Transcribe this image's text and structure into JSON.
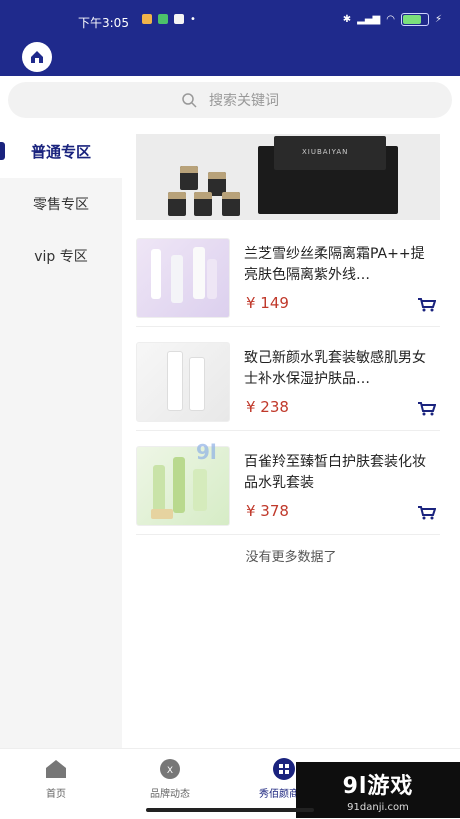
{
  "status_bar": {
    "time": "下午3:05",
    "battery_level": 0.8
  },
  "search": {
    "placeholder": "搜索关键词"
  },
  "sidebar": {
    "items": [
      {
        "label": "普通专区",
        "active": true
      },
      {
        "label": "零售专区",
        "active": false
      },
      {
        "label": "vip 专区",
        "active": false
      }
    ]
  },
  "banner": {
    "brand_text": "XIUBAIYAN"
  },
  "products": [
    {
      "name": "兰芝雪纱丝柔隔离霜PA++提亮肤色隔离紫外线…",
      "price": "¥ 149"
    },
    {
      "name": "致己新颜水乳套装敏感肌男女士补水保湿护肤品…",
      "price": "¥ 238"
    },
    {
      "name": "百雀羚至臻皙白护肤套装化妆品水乳套装",
      "price": "¥ 378"
    }
  ],
  "list_end_text": "没有更多数据了",
  "tabbar": {
    "items": [
      {
        "label": "首页",
        "active": false
      },
      {
        "label": "品牌动态",
        "active": false
      },
      {
        "label": "秀佰颜商城",
        "active": true
      }
    ]
  },
  "watermark": {
    "logo": "9l游戏",
    "url": "91danji.com",
    "center_mark": "9l"
  },
  "colors": {
    "primary": "#1f2a8c",
    "price": "#c0392b",
    "active": "#1a237e"
  }
}
